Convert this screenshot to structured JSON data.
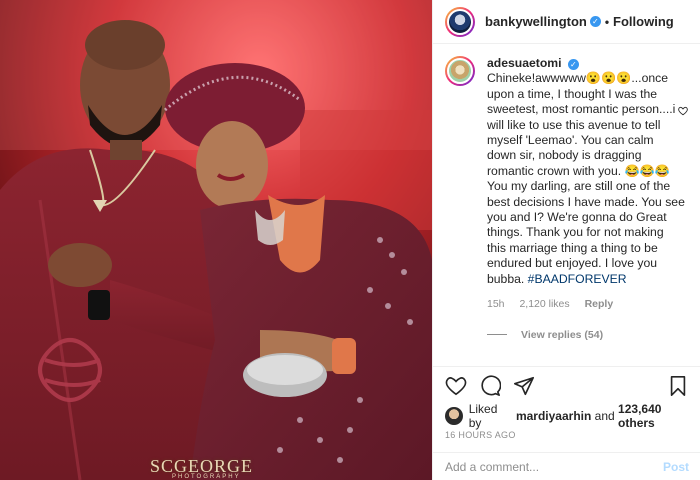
{
  "post": {
    "author": "bankywellington",
    "follow_state": "Following",
    "separator": "•"
  },
  "photo": {
    "watermark": "SCGEORGE",
    "watermark_sub": "PHOTOGRAPHY"
  },
  "comment": {
    "user": "adesuaetomi",
    "text_part1": "Chineke!awwwww😮😮😮...once upon a time, I thought I was the sweetest, most romantic person....i will like to use this avenue to tell myself 'Leemao'. You can calm down sir, nobody is dragging romantic crown with you. 😂😂😂 You my darling, are still one of the best decisions I have made. You see you and I? We're gonna do Great things. Thank you for not making this marriage thing a thing to be endured but enjoyed. I love you bubba. ",
    "hashtag": "#BAADFOREVER",
    "age": "15h",
    "likes": "2,120 likes",
    "reply_label": "Reply",
    "view_replies": "View replies (54)"
  },
  "likes": {
    "prefix": "Liked by ",
    "user": "mardiyaarhin",
    "middle": " and ",
    "count": "123,640 others"
  },
  "timestamp": "16 HOURS AGO",
  "add_comment": {
    "placeholder": "Add a comment...",
    "post_label": "Post"
  },
  "icons": {
    "verified": "verified-badge-icon",
    "like": "heart-icon",
    "comment": "comment-icon",
    "share": "paper-plane-icon",
    "save": "bookmark-icon"
  },
  "colors": {
    "verified": "#3897f0",
    "hashtag": "#00376b",
    "muted": "#8e8e8e",
    "post_disabled": "#b3dbff"
  }
}
